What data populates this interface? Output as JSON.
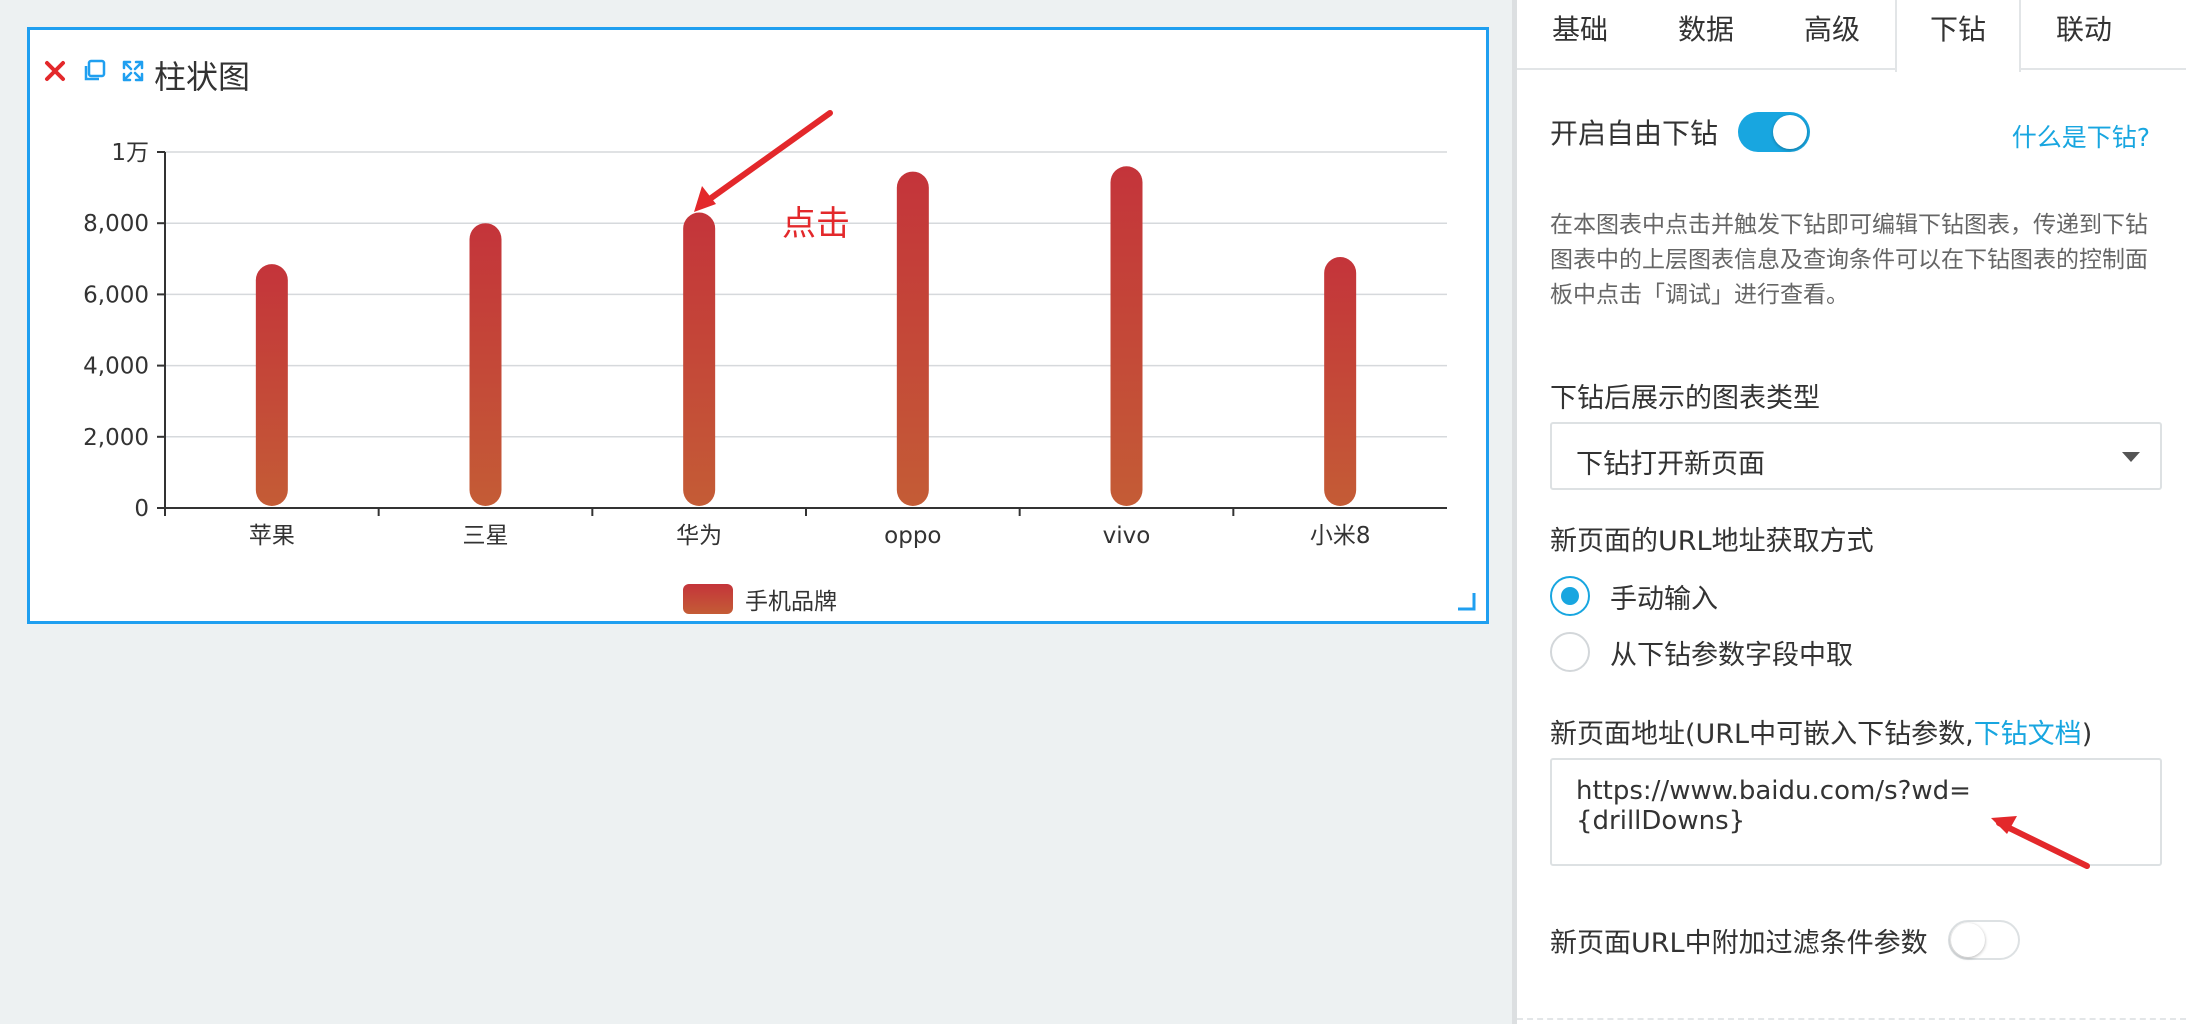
{
  "widget": {
    "title": "柱状图",
    "tools": [
      "close-icon",
      "copy-icon",
      "fullscreen-icon"
    ]
  },
  "annotation": {
    "label": "点击"
  },
  "chart_data": {
    "type": "bar",
    "categories": [
      "苹果",
      "三星",
      "华为",
      "oppo",
      "vivo",
      "小米8"
    ],
    "series": [
      {
        "name": "手机品牌",
        "values": [
          6850,
          8000,
          8300,
          9450,
          9600,
          7050
        ]
      }
    ],
    "ylim": [
      0,
      10000
    ],
    "yticks": [
      0,
      2000,
      4000,
      6000,
      8000,
      10000
    ],
    "ytick_labels": [
      "0",
      "2,000",
      "4,000",
      "6,000",
      "8,000",
      "1万"
    ],
    "grid": true,
    "legend": "bottom-center",
    "bar_colors": [
      "#c4343a",
      "#c45c36"
    ]
  },
  "panel": {
    "tabs": [
      "基础",
      "数据",
      "高级",
      "下钻",
      "联动"
    ],
    "active_tab": "下钻",
    "free_drill_label": "开启自由下钻",
    "free_drill_on": true,
    "help_link": "什么是下钻?",
    "description": "在本图表中点击并触发下钻即可编辑下钻图表，传递到下钻图表中的上层图表信息及查询条件可以在下钻图表的控制面板中点击「调试」进行查看。",
    "chart_type_label": "下钻后展示的图表类型",
    "chart_type_value": "下钻打开新页面",
    "url_method_label": "新页面的URL地址获取方式",
    "radio_manual": "手动输入",
    "radio_field": "从下钻参数字段中取",
    "url_label_prefix": "新页面地址(URL中可嵌入下钻参数,",
    "url_label_link": "下钻文档",
    "url_label_suffix": ")",
    "url_value": "https://www.baidu.com/s?wd={drillDowns}",
    "filter_label": "新页面URL中附加过滤条件参数",
    "filter_on": false
  },
  "colors": {
    "accent": "#18a6e0",
    "widget_border": "#1f9ff0",
    "annotation": "#e3282b"
  }
}
